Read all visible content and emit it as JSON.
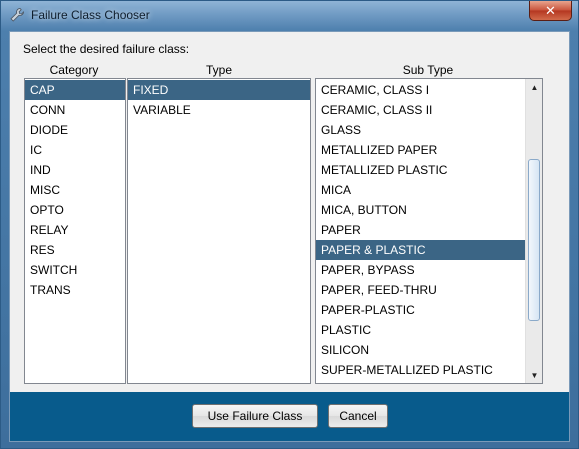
{
  "window": {
    "title": "Failure Class Chooser",
    "close_label": "✕"
  },
  "prompt": "Select the desired failure class:",
  "category": {
    "header": "Category",
    "items": [
      "CAP",
      "CONN",
      "DIODE",
      "IC",
      "IND",
      "MISC",
      "OPTO",
      "RELAY",
      "RES",
      "SWITCH",
      "TRANS"
    ],
    "selected": "CAP"
  },
  "type": {
    "header": "Type",
    "items": [
      "FIXED",
      "VARIABLE"
    ],
    "selected": "FIXED"
  },
  "subtype": {
    "header": "Sub Type",
    "items": [
      "CERAMIC, CLASS I",
      "CERAMIC, CLASS II",
      "GLASS",
      "METALLIZED PAPER",
      "METALLIZED PLASTIC",
      "MICA",
      "MICA, BUTTON",
      "PAPER",
      "PAPER & PLASTIC",
      "PAPER, BYPASS",
      "PAPER, FEED-THRU",
      "PAPER-PLASTIC",
      "PLASTIC",
      "SILICON",
      "SUPER-METALLIZED PLASTIC"
    ],
    "selected": "PAPER & PLASTIC"
  },
  "buttons": {
    "use": "Use Failure Class",
    "cancel": "Cancel"
  },
  "colors": {
    "selection": "#3b6585",
    "footer": "#085b8c"
  }
}
